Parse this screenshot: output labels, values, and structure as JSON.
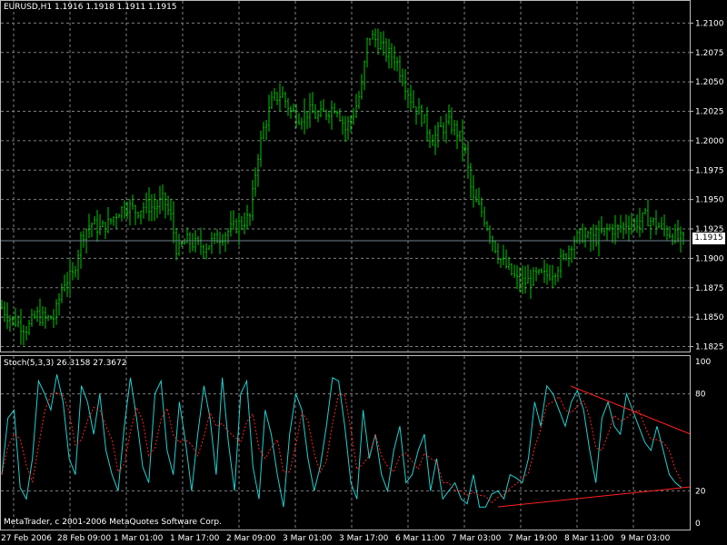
{
  "header": {
    "symbol_info": "EURUSD,H1  1.1916 1.1918 1.1911 1.1915",
    "stoch_info": "Stoch(5,3,3) 26.3158 27.3672",
    "copyright": "MetaTrader, c 2001-2006 MetaQuotes Software Corp."
  },
  "current_price": "1.1915",
  "colors": {
    "background": "#000000",
    "candles": "#00c800",
    "grid": "#7f7f7f",
    "stoch_main": "#20d0d0",
    "stoch_signal": "#ff2020",
    "trendline": "#ff2020",
    "price_line": "#708090"
  },
  "chart_data": [
    {
      "type": "ohlc",
      "title": "EURUSD,H1",
      "y_ticks": [
        "1.2100",
        "1.2075",
        "1.2050",
        "1.2025",
        "1.2000",
        "1.1975",
        "1.1950",
        "1.1925",
        "1.1900",
        "1.1875",
        "1.1850",
        "1.1825"
      ],
      "ylim": [
        1.182,
        1.2115
      ],
      "x_ticks": [
        "27 Feb 2006",
        "28 Feb 09:00",
        "1 Mar 01:00",
        "1 Mar 17:00",
        "2 Mar 09:00",
        "3 Mar 01:00",
        "3 Mar 17:00",
        "6 Mar 11:00",
        "7 Mar 03:00",
        "7 Mar 19:00",
        "8 Mar 11:00",
        "9 Mar 03:00"
      ],
      "close_path": [
        [
          0,
          1.186
        ],
        [
          10,
          1.185
        ],
        [
          20,
          1.1845
        ],
        [
          30,
          1.184
        ],
        [
          40,
          1.1852
        ],
        [
          50,
          1.1848
        ],
        [
          60,
          1.185
        ],
        [
          70,
          1.188
        ],
        [
          80,
          1.1885
        ],
        [
          90,
          1.192
        ],
        [
          100,
          1.193
        ],
        [
          110,
          1.1925
        ],
        [
          120,
          1.193
        ],
        [
          130,
          1.194
        ],
        [
          140,
          1.1945
        ],
        [
          150,
          1.194
        ],
        [
          160,
          1.1945
        ],
        [
          170,
          1.1943
        ],
        [
          180,
          1.195
        ],
        [
          188,
          1.1935
        ],
        [
          195,
          1.1905
        ],
        [
          205,
          1.1915
        ],
        [
          215,
          1.1912
        ],
        [
          225,
          1.191
        ],
        [
          235,
          1.1915
        ],
        [
          245,
          1.192
        ],
        [
          255,
          1.1925
        ],
        [
          265,
          1.193
        ],
        [
          275,
          1.1935
        ],
        [
          283,
          1.1985
        ],
        [
          290,
          1.201
        ],
        [
          300,
          1.2035
        ],
        [
          310,
          1.204
        ],
        [
          320,
          1.2025
        ],
        [
          330,
          1.202
        ],
        [
          340,
          1.2025
        ],
        [
          350,
          1.202
        ],
        [
          360,
          1.2025
        ],
        [
          370,
          1.203
        ],
        [
          380,
          1.201
        ],
        [
          390,
          1.2025
        ],
        [
          398,
          1.2045
        ],
        [
          405,
          1.209
        ],
        [
          415,
          1.2085
        ],
        [
          425,
          1.2075
        ],
        [
          435,
          1.207
        ],
        [
          445,
          1.205
        ],
        [
          455,
          1.203
        ],
        [
          465,
          1.202
        ],
        [
          475,
          1.2
        ],
        [
          485,
          1.201
        ],
        [
          495,
          1.2015
        ],
        [
          505,
          1.2005
        ],
        [
          512,
          1.199
        ],
        [
          520,
          1.195
        ],
        [
          530,
          1.194
        ],
        [
          540,
          1.192
        ],
        [
          550,
          1.19
        ],
        [
          560,
          1.189
        ],
        [
          570,
          1.188
        ],
        [
          580,
          1.188
        ],
        [
          590,
          1.1885
        ],
        [
          600,
          1.1885
        ],
        [
          610,
          1.189
        ],
        [
          620,
          1.19
        ],
        [
          630,
          1.1915
        ],
        [
          640,
          1.192
        ],
        [
          650,
          1.1915
        ],
        [
          660,
          1.192
        ],
        [
          670,
          1.1925
        ],
        [
          680,
          1.1925
        ],
        [
          690,
          1.193
        ],
        [
          700,
          1.193
        ],
        [
          710,
          1.1935
        ],
        [
          720,
          1.193
        ],
        [
          730,
          1.1925
        ],
        [
          740,
          1.192
        ],
        [
          750,
          1.1915
        ]
      ]
    },
    {
      "type": "line",
      "title": "Stoch(5,3,3)",
      "y_ticks": [
        "100",
        "80",
        "20",
        "0"
      ],
      "ylim": [
        0,
        100
      ],
      "series": [
        {
          "name": "main",
          "values": [
            30,
            65,
            70,
            22,
            15,
            40,
            88,
            80,
            70,
            92,
            75,
            40,
            30,
            85,
            75,
            55,
            80,
            45,
            30,
            20,
            60,
            90,
            65,
            35,
            25,
            80,
            88,
            45,
            30,
            75,
            50,
            20,
            55,
            85,
            65,
            30,
            90,
            50,
            20,
            80,
            88,
            35,
            15,
            70,
            55,
            30,
            10,
            55,
            80,
            70,
            40,
            20,
            35,
            60,
            90,
            88,
            60,
            25,
            15,
            70,
            40,
            55,
            30,
            20,
            45,
            60,
            25,
            30,
            45,
            55,
            20,
            40,
            15,
            20,
            25,
            15,
            12,
            30,
            10,
            10,
            18,
            20,
            15,
            30,
            28,
            25,
            40,
            75,
            60,
            85,
            80,
            70,
            60,
            75,
            82,
            70,
            45,
            25,
            65,
            75,
            60,
            55,
            80,
            70,
            60,
            50,
            45,
            60,
            45,
            30,
            25,
            22
          ]
        }
      ]
    }
  ]
}
